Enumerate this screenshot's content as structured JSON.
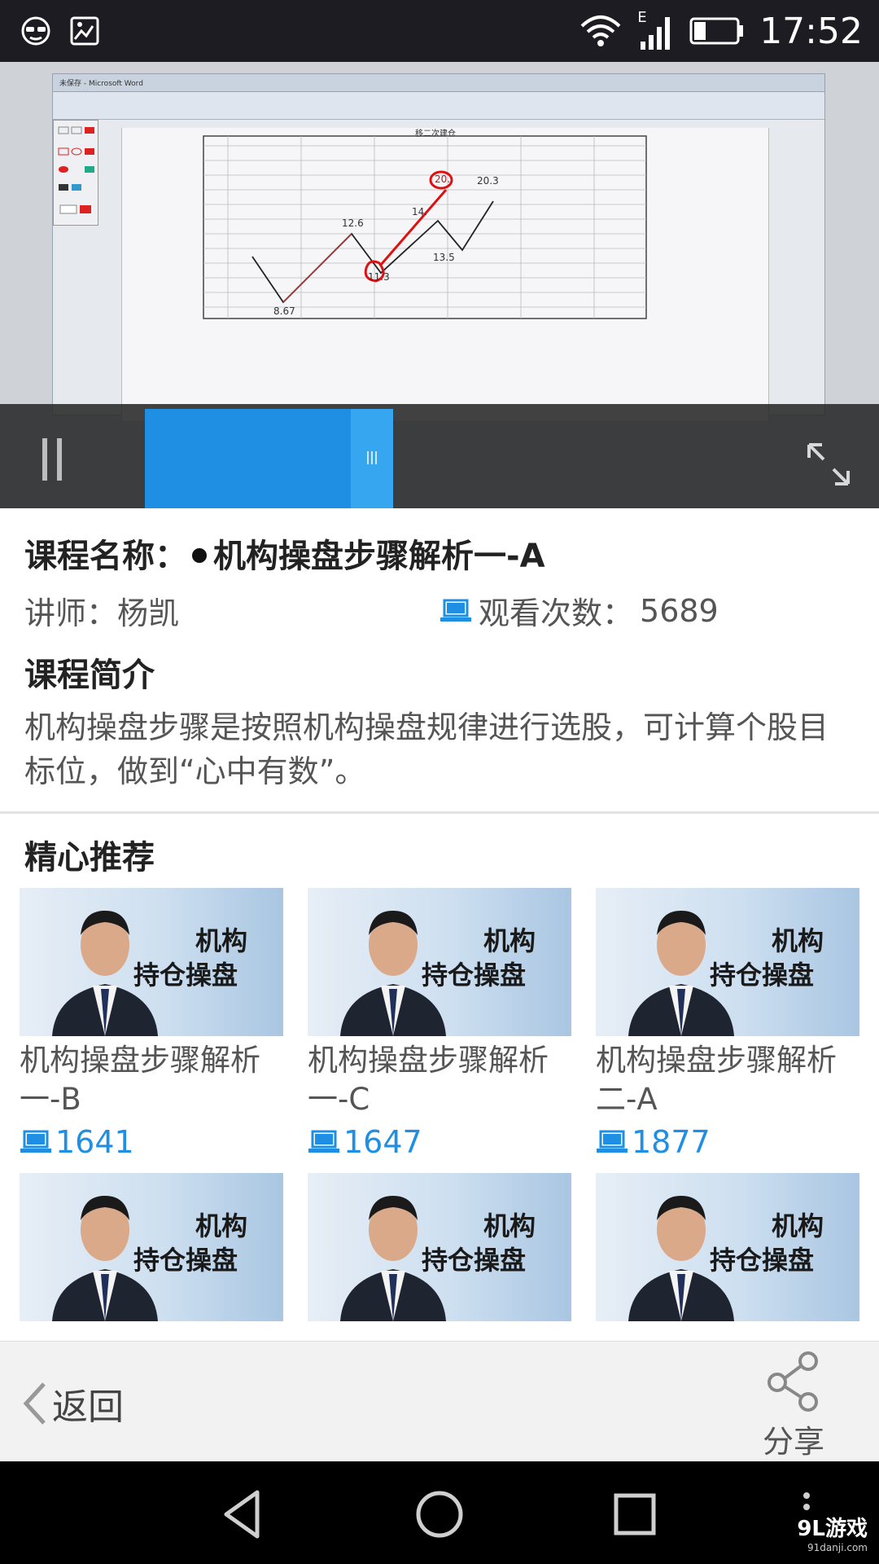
{
  "status_bar": {
    "time": "17:52",
    "network_label": "E"
  },
  "course": {
    "title_prefix": "课程名称：",
    "title": "机构操盘步骤解析一-A",
    "instructor": "讲师：杨凯",
    "views_label": "观看次数：",
    "views_value": "5689",
    "intro_heading": "课程简介",
    "intro_text": "机构操盘步骤是按照机构操盘规律进行选股，可计算个股目标位，做到“心中有数”。"
  },
  "video": {
    "doc_title": "未保存 - Microsoft Word",
    "chart_heading": "移二次建仓",
    "chart_labels": [
      "8.67",
      "12.6",
      "11.3",
      "20.",
      "20.3",
      "14.",
      "13.5"
    ],
    "progress_percent": 28
  },
  "recommendations": {
    "heading": "精心推荐",
    "thumb_caption_line1": "机构",
    "thumb_caption_line2": "持仓操盘",
    "items": [
      {
        "name": "机构操盘步骤解析一-B",
        "views": "1641"
      },
      {
        "name": "机构操盘步骤解析一-C",
        "views": "1647"
      },
      {
        "name": "机构操盘步骤解析二-A",
        "views": "1877"
      },
      {
        "name": "",
        "views": ""
      },
      {
        "name": "",
        "views": ""
      },
      {
        "name": "",
        "views": ""
      }
    ]
  },
  "bottom_bar": {
    "back_label": "返回",
    "share_label": "分享"
  },
  "watermark": {
    "brand": "9L游戏",
    "site": "91danji.com"
  },
  "colors": {
    "accent": "#1f8fe3",
    "status_bar": "#1c1c22",
    "bottom_bar": "#f2f2f2"
  }
}
